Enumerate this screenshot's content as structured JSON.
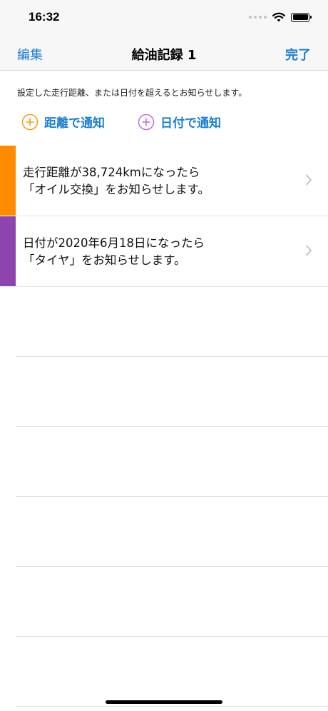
{
  "status": {
    "time": "16:32"
  },
  "nav": {
    "edit_label": "編集",
    "title": "給油記録 1",
    "done_label": "完了"
  },
  "description": "設定した走行距離、または日付を超えるとお知らせします。",
  "actions": {
    "distance_label": "距離で通知",
    "date_label": "日付で通知",
    "distance_color": "#f39c12",
    "date_color": "#c56be3"
  },
  "notifications": [
    {
      "line1": "走行距離が38,724kmになったら",
      "line2": "「オイル交換」をお知らせします。",
      "color": "#ff8c00"
    },
    {
      "line1": "日付が2020年6月18日になったら",
      "line2": "「タイヤ」をお知らせします。",
      "color": "#8e44ad"
    }
  ],
  "colors": {
    "accent": "#1c7ed6"
  }
}
